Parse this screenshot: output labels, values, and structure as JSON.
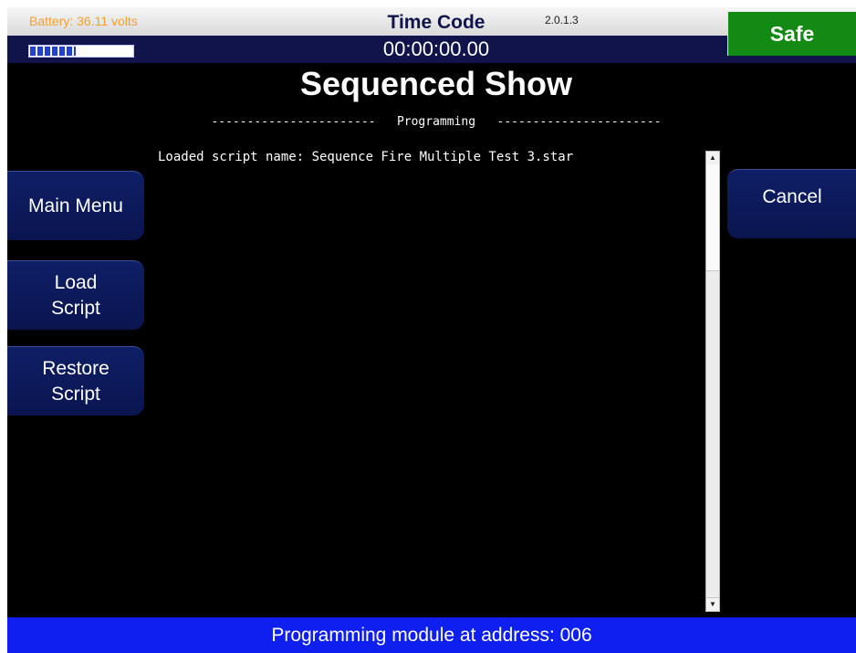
{
  "header": {
    "battery_text": "Battery: 36.11 volts",
    "battery_level": 0.45,
    "timecode_label": "Time Code",
    "version": "2.0.1.3",
    "timecode_value": "00:00:00.00",
    "safe_label": "Safe",
    "safe_color": "#138a13"
  },
  "page": {
    "title": "Sequenced Show",
    "section_header": "-----------------------   Programming   -----------------------",
    "loaded_script_line": "Loaded script name: Sequence Fire Multiple Test 3.star"
  },
  "left_buttons": [
    {
      "label": "Main Menu"
    },
    {
      "label": "Load\nScript"
    },
    {
      "label": "Restore\nScript"
    }
  ],
  "right_buttons": [
    {
      "label": "Cancel"
    }
  ],
  "scrollbar": {
    "up_icon": "▲",
    "down_icon": "▼"
  },
  "status": {
    "text": "Programming module at address: 006",
    "color": "#0f1ff0"
  }
}
